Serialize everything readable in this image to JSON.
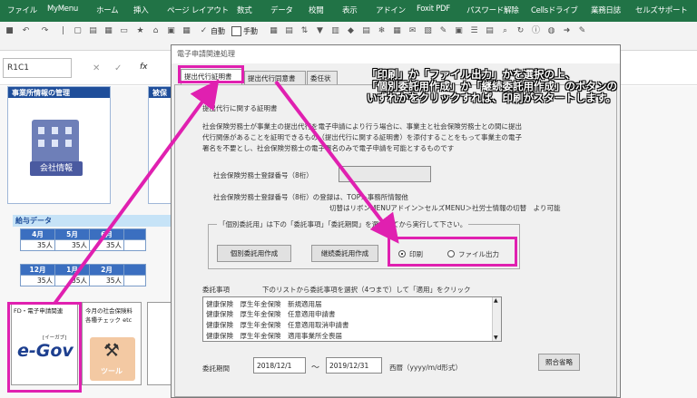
{
  "ribbon": {
    "tabs": [
      "ファイル",
      "MyMenu",
      "ホーム",
      "挿入",
      "ページ レイアウト",
      "数式",
      "データ",
      "校閲",
      "表示",
      "アドイン",
      "Foxit PDF",
      "パスワード解除",
      "Cellsドライブ",
      "業務日誌",
      "セルズサポート"
    ],
    "auto_label": "自動",
    "manual_label": "手動"
  },
  "formula_bar": {
    "name_box": "R1C1",
    "fx": "fx"
  },
  "sheet": {
    "office_card_title": "事業所情報の管理",
    "company_button": "会社情報",
    "second_card_title": "被保",
    "salary": {
      "title": "給与データ",
      "row1_months": [
        "4月",
        "5月",
        "6月"
      ],
      "row1_values": [
        "35人",
        "35人",
        "35人"
      ],
      "row2_months": [
        "12月",
        "1月",
        "2月"
      ],
      "row2_values": [
        "35人",
        "35人",
        "35人"
      ]
    },
    "egov_card": {
      "title": "FD・電子申請関連",
      "logo_main": "e-Gov",
      "logo_sub": "[イーガブ]"
    },
    "check_card": {
      "line1": "今月の社会保険料",
      "line2": "各種チェック etc",
      "tool_label": "ツール"
    }
  },
  "dialog": {
    "title": "電子申請関連処理",
    "tabs": [
      "提出代行証明書",
      "提出代行同意書",
      "委任状"
    ],
    "section_heading": "提出代行に関する証明書",
    "description": [
      "社会保険労務士が事業主の提出代行を電子申請により行う場合に、事業主と社会保険労務士との間に提出",
      "代行関係があることを証明できるもの（提出代行に関する証明書）を添付することをもって事業主の電子",
      "署名を不要とし、社会保険労務士の電子署名のみで電子申請を可能とするものです"
    ],
    "reg_label": "社会保険労務士登録番号（8桁）",
    "reg_note_line1": "社会保険労務士登録番号（8桁）の登録は、TOP＞事務所情報他",
    "reg_note_line2": "切替はリボンMENUアドイン＞セルズMENU＞社労士情報の切替　より可能",
    "group_caption": "「個別委託用」は下の「委託事項」「委託期間」を選択してから実行して下さい。",
    "btn_individual": "個別委託用作成",
    "btn_continuous": "継続委託用作成",
    "radio_print": "印刷",
    "radio_file": "ファイル出力",
    "matters_label": "委託事項",
    "matters_hint": "下のリストから委託事項を選択（4つまで）して「適用」をクリック",
    "matters_items": [
      "健康保険　厚生年金保険　新規適用届",
      "健康保険　厚生年金保険　任意適用申請書",
      "健康保険　厚生年金保険　任意適用取消申請書",
      "健康保険　厚生年金保険　適用事業所全喪届"
    ],
    "period_label": "委託期間",
    "period_from": "2018/12/1",
    "period_sep": "～",
    "period_to": "2019/12/31",
    "period_format": "西暦（yyyy/m/d形式）",
    "btn_omit": "照合省略"
  },
  "annotation": {
    "line1": "「印刷」か「ファイル出力」かを選択の上、",
    "line2": "「個別委託用作成」か「継続委託用作成」のボタンの",
    "line3": "いずれかをクリックすれば、印刷がスタートします。"
  },
  "colors": {
    "ribbon": "#217346",
    "highlight": "#e020b0",
    "card_header": "#1f4e9a"
  }
}
